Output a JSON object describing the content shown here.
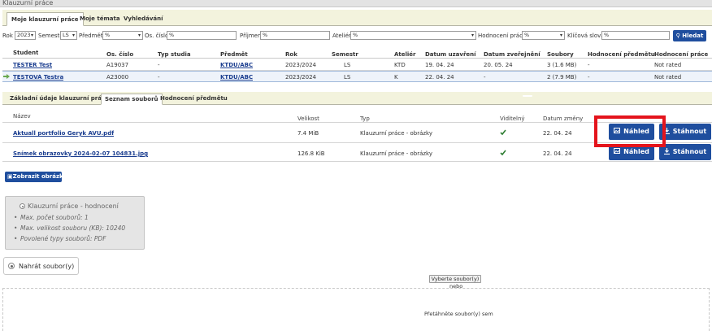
{
  "window": {
    "title": "Klauzurní práce"
  },
  "tabs": [
    {
      "label": "Moje klauzurní práce",
      "active": true
    },
    {
      "label": "Moje témata",
      "active": false
    },
    {
      "label": "Vyhledávání",
      "active": false
    }
  ],
  "filters": {
    "rok_label": "Rok",
    "rok_value": "2023",
    "semestr_label": "Semestr",
    "semestr_value": "LS",
    "predmet_label": "Předmět",
    "predmet_value": "%",
    "os_cislo_label": "Os. číslo",
    "os_cislo_value": "%",
    "prijmeni_label": "Příjmení",
    "prijmeni_value": "%",
    "atelier_label": "Ateliér",
    "atelier_value": "%",
    "hodnoceni_label": "Hodnocení práce",
    "hodnoceni_value": "%",
    "klicova_slova_label": "Klíčová slova",
    "klicova_slova_value": "%",
    "search_label": "Hledat"
  },
  "grid": {
    "headers": [
      "Student",
      "Os. číslo",
      "Typ studia",
      "Předmět",
      "Rok",
      "Semestr",
      "Ateliér",
      "Datum uzavření",
      "Datum zveřejnění",
      "Soubory",
      "Hodnocení předmětu",
      "Hodnocení práce"
    ],
    "rows": [
      {
        "student": "TESTER Test",
        "os_cislo": "A19037",
        "typ": "-",
        "predmet": "KTDU/ABC",
        "rok": "2023/2024",
        "semestr": "LS",
        "atelier": "KTD",
        "uzavreni": "19. 04. 24",
        "zverejneni": "20. 05. 24",
        "soubory": "3 (1.6 MB)",
        "hod_predmetu": "-",
        "hod_prace": "Not rated"
      },
      {
        "student": "TESTOVÁ Testra",
        "os_cislo": "A23000",
        "typ": "-",
        "predmet": "KTDU/ABC",
        "rok": "2023/2024",
        "semestr": "LS",
        "atelier": "K",
        "uzavreni": "22. 04. 24",
        "zverejneni": "-",
        "soubory": "2 (7.9 MB)",
        "hod_predmetu": "-",
        "hod_prace": "Not rated"
      }
    ]
  },
  "subtabs": [
    {
      "label": "Základní údaje klauzurní práce",
      "active": false
    },
    {
      "label": "Seznam souborů",
      "active": true
    },
    {
      "label": "Hodnocení předmětu",
      "active": false
    }
  ],
  "files": {
    "headers": {
      "name": "Název",
      "size": "Velikost",
      "type": "Typ",
      "visible": "Viditelný",
      "changed": "Datum změny"
    },
    "rows": [
      {
        "name": "Aktuall portfolio Geryk AVU.pdf",
        "size": "7.4 MiB",
        "type": "Klauzurní práce - obrázky",
        "changed": "22. 04. 24"
      },
      {
        "name": "Snímek obrazovky 2024-02-07 104831.jpg",
        "size": "126.8 KiB",
        "type": "Klauzurní práce - obrázky",
        "changed": "22. 04. 24"
      }
    ],
    "preview_label": "Náhled",
    "download_label": "Stáhnout"
  },
  "show_images_label": "Zobrazit obrázky",
  "info": {
    "title": "Klauzurní práce - hodnocení",
    "lines": [
      "Max. počet souborů: 1",
      "Max. velikost souboru (KB): 10240",
      "Povolené typy souborů: PDF"
    ]
  },
  "upload": {
    "label": "Nahrát soubor(y)",
    "choose_label": "Vyberte soubor(y)",
    "nebo": "nebo",
    "drop_text": "Přetáhněte soubor(y) sem"
  },
  "colors": {
    "accent_blue": "#1f4e9e",
    "highlight_red": "#e4141c",
    "tab_bg": "#f3f3dd",
    "check_green": "#2e7d32"
  }
}
